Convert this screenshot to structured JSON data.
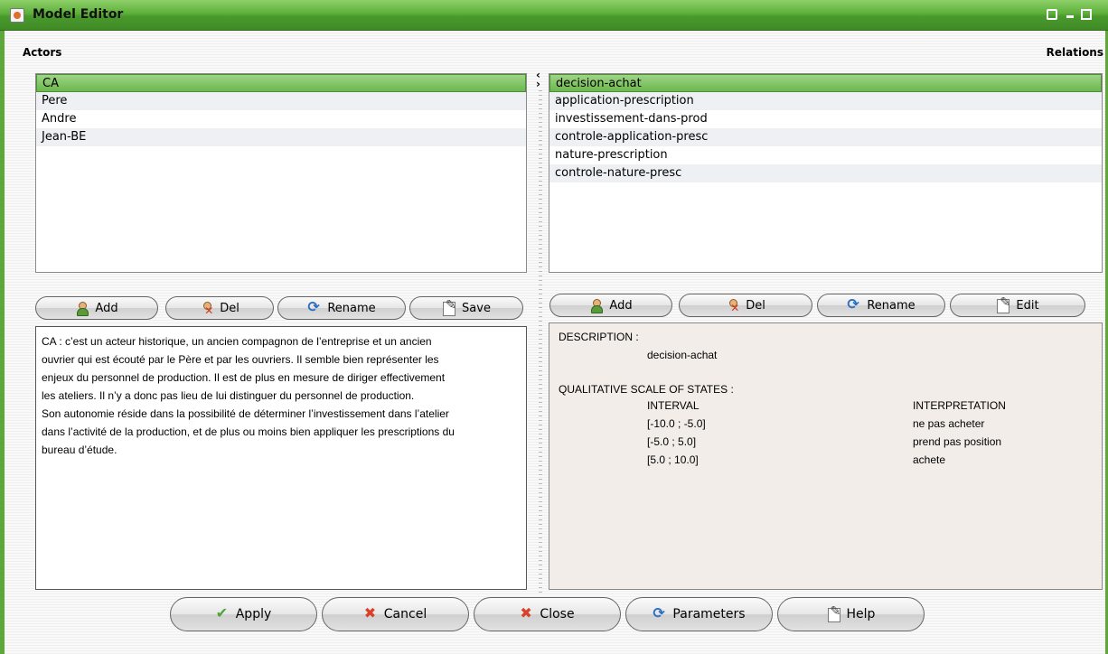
{
  "window": {
    "title": "Model Editor",
    "controls": [
      "maximize-icon",
      "minimize-icon",
      "restore-icon"
    ],
    "accent_color": "#5ea83a"
  },
  "actors": {
    "label": "Actors",
    "items": [
      "CA",
      "Pere",
      "Andre",
      "Jean-BE"
    ],
    "selected": "CA",
    "buttons": {
      "add": "Add",
      "del": "Del",
      "rename": "Rename",
      "save": "Save"
    },
    "description": "CA : c’est un acteur historique, un ancien compagnon de l’entreprise et un ancien\nouvrier qui est écouté par le Père et par les ouvriers. Il semble bien représenter les\nenjeux du personnel de production. Il est de plus en mesure de diriger effectivement\nles ateliers. Il n’y a donc pas lieu de lui distinguer du personnel de production.\nSon autonomie réside dans la possibilité de déterminer l’investissement dans l’atelier\ndans l’activité de la production, et de plus ou moins bien appliquer les prescriptions du\nbureau d’étude."
  },
  "relations": {
    "label": "Relations",
    "items": [
      "decision-achat",
      "application-prescription",
      "investissement-dans-prod",
      "controle-application-presc",
      "nature-prescription",
      "controle-nature-presc"
    ],
    "selected": "decision-achat",
    "buttons": {
      "add": "Add",
      "del": "Del",
      "rename": "Rename",
      "edit": "Edit"
    },
    "details": {
      "description_label": "DESCRIPTION :",
      "description_value": "decision-achat",
      "scale_label": "QUALITATIVE SCALE OF STATES :",
      "interval_header": "INTERVAL",
      "interpretation_header": "INTERPRETATION",
      "rows": [
        {
          "interval": "[-10.0 ; -5.0]",
          "interpretation": "ne pas acheter"
        },
        {
          "interval": "[-5.0 ; 5.0]",
          "interpretation": "prend pas position"
        },
        {
          "interval": "[5.0 ; 10.0]",
          "interpretation": "achete"
        }
      ]
    }
  },
  "footer": {
    "apply": "Apply",
    "cancel": "Cancel",
    "close": "Close",
    "parameters": "Parameters",
    "help": "Help"
  },
  "splitter": {
    "left_arrow": "‹",
    "right_arrow": "›"
  }
}
